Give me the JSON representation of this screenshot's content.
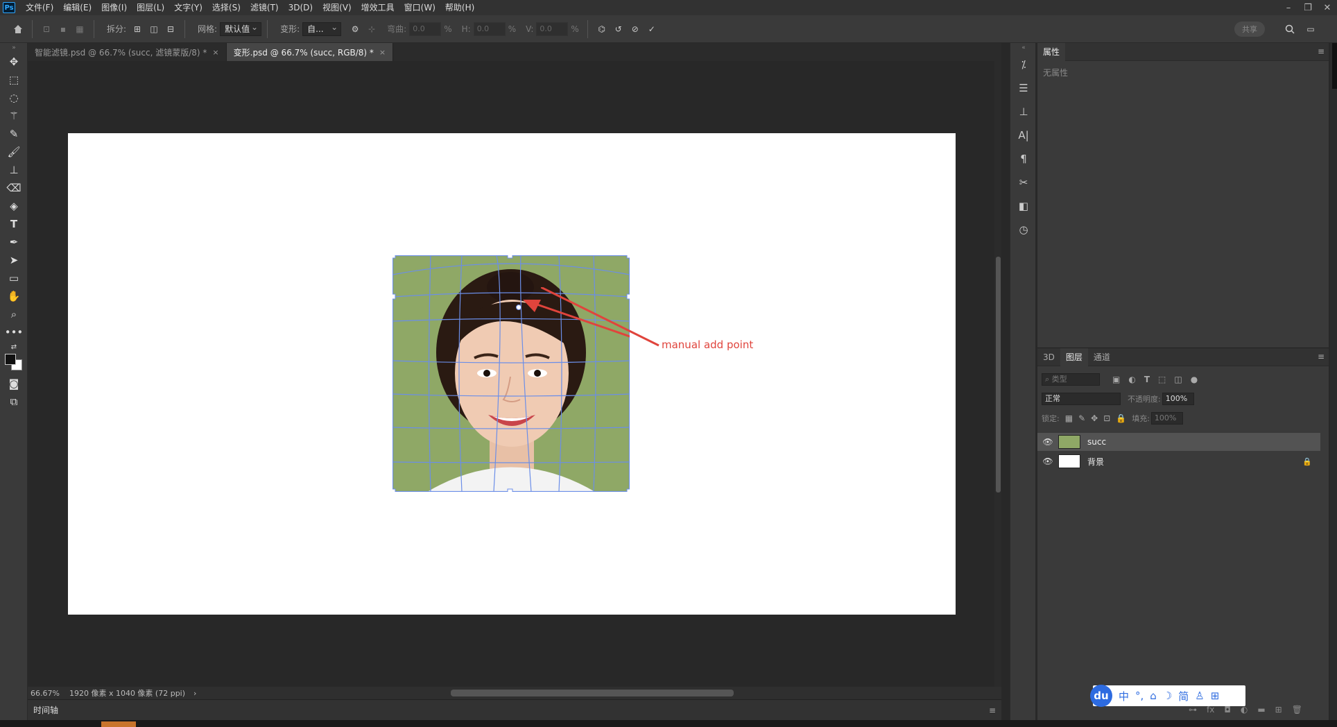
{
  "app": {
    "logo": "Ps"
  },
  "menu": [
    "文件(F)",
    "编辑(E)",
    "图像(I)",
    "图层(L)",
    "文字(Y)",
    "选择(S)",
    "滤镜(T)",
    "3D(D)",
    "视图(V)",
    "增效工具",
    "窗口(W)",
    "帮助(H)"
  ],
  "window_controls": {
    "minimize": "–",
    "restore": "❐",
    "close": "✕"
  },
  "options": {
    "split_label": "拆分:",
    "grid_label": "网格:",
    "grid_value": "默认值",
    "warp_label": "变形:",
    "warp_value": "自...",
    "bend_label": "弯曲:",
    "bend_value": "0.0",
    "h_label": "H:",
    "h_value": "0.0",
    "v_label": "V:",
    "v_value": "0.0",
    "percent": "%",
    "share": "共享"
  },
  "tabs": [
    {
      "label": "智能滤镜.psd @ 66.7% (succ, 滤镜蒙版/8) *",
      "close": "×"
    },
    {
      "label": "变形.psd @ 66.7% (succ, RGB/8) *",
      "close": "×"
    }
  ],
  "annotation": "manual add point",
  "status": {
    "zoom": "66.67%",
    "doc_info": "1920 像素 x 1040 像素 (72 ppi)",
    "arrow": "›"
  },
  "timeline": "时间轴",
  "properties": {
    "tab": "属性",
    "empty": "无属性"
  },
  "layers_panel": {
    "tabs": [
      "3D",
      "图层",
      "通道"
    ],
    "filter_placeholder": "类型",
    "blend_mode": "正常",
    "opacity_label": "不透明度:",
    "opacity_value": "100%",
    "lock_label": "锁定:",
    "fill_label": "填充:",
    "fill_value": "100%",
    "layers": [
      {
        "name": "succ",
        "selected": true
      },
      {
        "name": "背景",
        "locked": true
      }
    ]
  },
  "ime": {
    "logo": "du",
    "items": [
      "中",
      "°,",
      "⌂",
      "☽",
      "简",
      "♙",
      "⊞"
    ]
  },
  "colors": {
    "accent_mesh": "#6b8ee8",
    "annotation": "#e0443c",
    "photo_bg": "#8fa866"
  }
}
